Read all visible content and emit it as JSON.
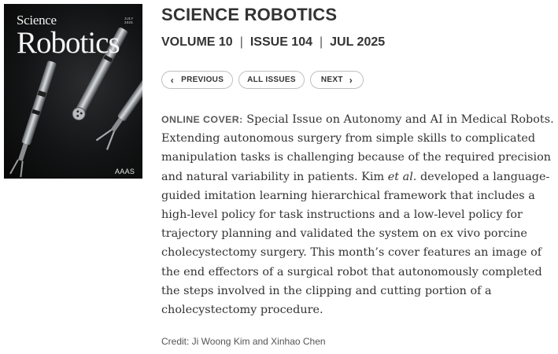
{
  "cover": {
    "brand_top": "Science",
    "brand_main": "Robotics",
    "issue_date": "JULY 2025",
    "publisher": "AAAS"
  },
  "journal": {
    "title": "SCIENCE ROBOTICS"
  },
  "issue": {
    "volume": "VOLUME 10",
    "number": "ISSUE 104",
    "date": "JUL 2025",
    "separator": "|"
  },
  "nav": {
    "previous": "PREVIOUS",
    "all_issues": "ALL ISSUES",
    "next": "NEXT"
  },
  "description": {
    "label": "ONLINE COVER:",
    "text_before_italic": " Special Issue on Autonomy and AI in Medical Robots. Extending autonomous surgery from simple skills to complicated manipulation tasks is challenging because of the required precision and natural variability in patients. Kim ",
    "italic": "et al.",
    "text_after_italic": " developed a language-guided imitation learning hierarchical framework that includes a high-level policy for task instructions and a low-level policy for trajectory planning and validated the system on ex vivo porcine cholecystectomy surgery. This month’s cover features an image of the end effectors of a surgical robot that autonomously completed the steps involved in the clipping and cutting portion of a cholecystectomy procedure."
  },
  "credit": "Credit: Ji Woong Kim and Xinhao Chen"
}
